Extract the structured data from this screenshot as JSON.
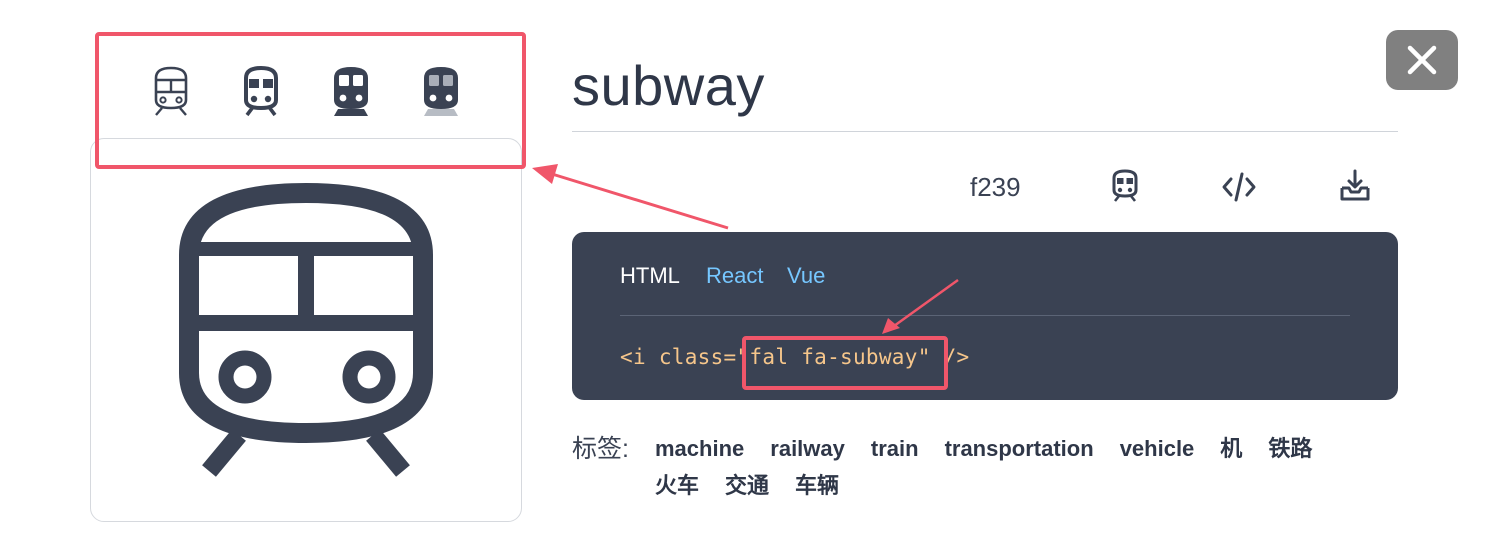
{
  "icon": {
    "name": "subway",
    "unicode": "f239",
    "variants": [
      "subway-light-icon",
      "subway-regular-icon",
      "subway-solid-icon",
      "subway-duotone-icon"
    ]
  },
  "tools": {
    "items": [
      "subway-icon",
      "code-icon",
      "download-icon"
    ]
  },
  "code": {
    "tabs": [
      "HTML",
      "React",
      "Vue"
    ],
    "active_tab": "HTML",
    "snippet": "<i class=\"fal fa-subway\" />"
  },
  "tags": {
    "label": "标签:",
    "items": [
      "machine",
      "railway",
      "train",
      "transportation",
      "vehicle",
      "机",
      "铁路",
      "火车",
      "交通",
      "车辆"
    ]
  },
  "colors": {
    "icon": "#3a4253",
    "panel": "#3a4253",
    "tab_inactive": "#76c7ff",
    "code_text": "#f6c68b",
    "highlight": "#f0566a",
    "close_bg": "#808080"
  }
}
